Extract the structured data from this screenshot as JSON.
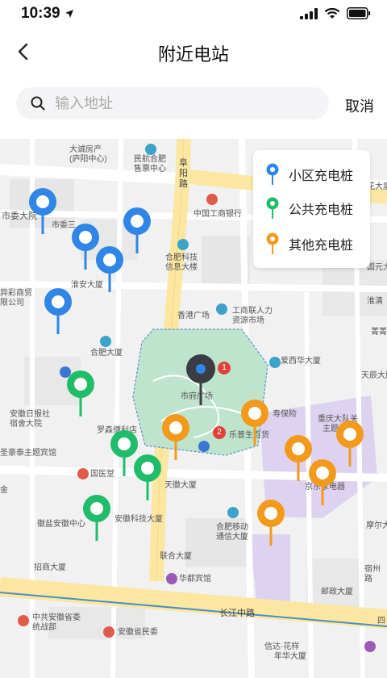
{
  "status": {
    "time": "10:39"
  },
  "nav": {
    "title": "附近电站"
  },
  "search": {
    "placeholder": "输入地址",
    "cancel_label": "取消"
  },
  "colors": {
    "community": "#2f86e6",
    "public": "#1fbd6a",
    "other": "#f39a1c",
    "park": "#bfe4cd",
    "mall": "#ddd2f0",
    "road": "#ffffff",
    "main_road": "#fbe7a2"
  },
  "legend": {
    "items": [
      {
        "key": "community",
        "label": "小区充电桩"
      },
      {
        "key": "public",
        "label": "公共充电桩"
      },
      {
        "key": "other",
        "label": "其他充电桩"
      }
    ]
  },
  "map_labels": {
    "dacheng": "大诚房产",
    "dacheng2": "(庐阳中心)",
    "minhang": "民航合肥",
    "minhang2": "售票中心",
    "fuyang_road": "阜阳路",
    "shiwei": "市委大院",
    "shiwei3": "市委三",
    "huaxing": "花大厦",
    "icbc": "中国工商银行",
    "hefei_tech": "合肥科技",
    "hefei_tech2": "信息大楼",
    "yi_colorful": "异彩商贸",
    "yi_colorful2": "限公司",
    "huaian": "淮安大厦",
    "xianggang": "香港广场",
    "gongshang": "工商联人力",
    "gongshang2": "资源市场",
    "guoyuan": "国元大",
    "huaixin": "淮清",
    "hefei_dasha": "合肥大厦",
    "aixi": "爱西华大厦",
    "puhuang": "菁菁",
    "tianchen": "天辰大厦",
    "anhui_daily": "安徽日报社",
    "anhui_daily2": "宿舍大院",
    "square": "市府广场",
    "shengbao": "寿保险",
    "luosen": "罗森便利店",
    "chongqing": "重庆大队关",
    "chongqing2": "主题",
    "shengmei": "圣豪泰主题宾馆",
    "lepu": "乐普生百货",
    "guoyitang": "国医堂",
    "tianhui": "天徽大厦",
    "jingdong": "京东家电器",
    "jin": "金",
    "anhui_tech": "安徽科技大厦",
    "huiyan": "徽盐安徽中心",
    "hefei_mobile": "合肥移动",
    "hefei_mobile2": "通信大厦",
    "moer": "摩尔大",
    "lianhe": "联合大厦",
    "zhaoshang": "招商大厦",
    "huadu": "华都宾馆",
    "youzheng": "邮政大厦",
    "suzhou": "宿州",
    "suzhou2": "路",
    "changjiang": "长江中路",
    "cpc_anhui": "中共安徽省委",
    "cpc_anhui2": "统战部",
    "minwei": "安徽省民委",
    "xinda": "信达·花样",
    "xinda2": "年华大厦",
    "si": "四"
  }
}
